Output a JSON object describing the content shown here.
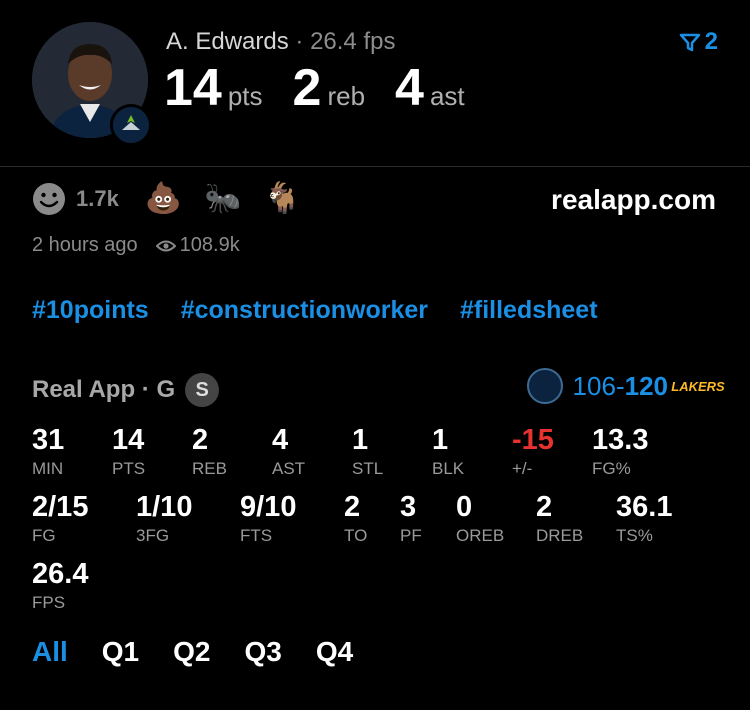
{
  "player": {
    "name": "A. Edwards",
    "separator": "·",
    "fps_label": "26.4 fps",
    "summary": [
      {
        "value": "14",
        "label": "pts"
      },
      {
        "value": "2",
        "label": "reb"
      },
      {
        "value": "4",
        "label": "ast"
      }
    ]
  },
  "filter": {
    "count": "2",
    "icon": "filter-icon",
    "color": "#1a8fe3"
  },
  "reactions": {
    "smile_count": "1.7k",
    "emojis": [
      "💩",
      "🐜",
      "🐐"
    ]
  },
  "site": "realapp.com",
  "meta": {
    "time_ago": "2 hours ago",
    "views": "108.9k"
  },
  "tags": [
    "#10points",
    "#constructionworker",
    "#filledsheet"
  ],
  "boxscore": {
    "source": "Real App · G",
    "badge": "S",
    "score_home": "106",
    "score_dash": "-",
    "score_away": "120",
    "away_team_text": "LAKERS",
    "rows": [
      [
        {
          "value": "31",
          "label": "MIN"
        },
        {
          "value": "14",
          "label": "PTS"
        },
        {
          "value": "2",
          "label": "REB"
        },
        {
          "value": "4",
          "label": "AST"
        },
        {
          "value": "1",
          "label": "STL"
        },
        {
          "value": "1",
          "label": "BLK"
        },
        {
          "value": "-15",
          "label": "+/-"
        },
        {
          "value": "13.3",
          "label": "FG%"
        }
      ],
      [
        {
          "value": "2/15",
          "label": "FG"
        },
        {
          "value": "1/10",
          "label": "3FG"
        },
        {
          "value": "9/10",
          "label": "FTS"
        },
        {
          "value": "2",
          "label": "TO"
        },
        {
          "value": "3",
          "label": "PF"
        },
        {
          "value": "0",
          "label": "OREB"
        },
        {
          "value": "2",
          "label": "DREB"
        },
        {
          "value": "36.1",
          "label": "TS%"
        }
      ],
      [
        {
          "value": "26.4",
          "label": "FPS"
        }
      ]
    ]
  },
  "tabs": [
    "All",
    "Q1",
    "Q2",
    "Q3",
    "Q4"
  ],
  "active_tab": "All",
  "colors": {
    "accent": "#1a8fe3",
    "negative": "#e8322f",
    "background": "#000000"
  }
}
